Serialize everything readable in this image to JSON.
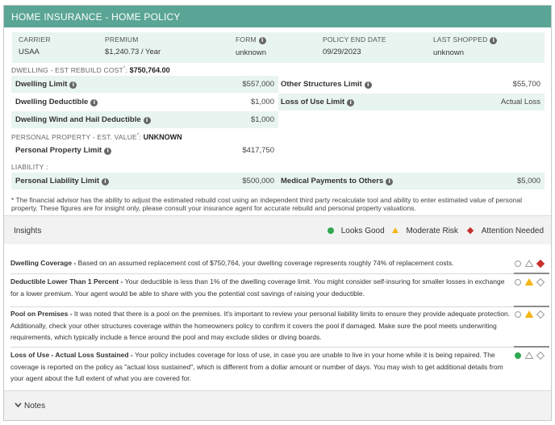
{
  "header": {
    "title": "HOME INSURANCE - HOME POLICY"
  },
  "summary": {
    "carrier": {
      "label": "CARRIER",
      "value": "USAA"
    },
    "premium": {
      "label": "PREMIUM",
      "value": "$1,240.73 / Year"
    },
    "form": {
      "label": "FORM",
      "value": "unknown"
    },
    "end_date": {
      "label": "POLICY END DATE",
      "value": "09/29/2023"
    },
    "last_shopped": {
      "label": "LAST SHOPPED",
      "value": "unknown"
    }
  },
  "dwelling": {
    "title": "DWELLING - EST REBUILD COST",
    "marker": "*",
    "sep": ":",
    "value": "$750,764.00",
    "rows": {
      "dwelling_limit": {
        "label": "Dwelling Limit",
        "value": "$557,000"
      },
      "dwelling_deductible": {
        "label": "Dwelling Deductible",
        "value": "$1,000"
      },
      "wind_hail": {
        "label": "Dwelling Wind and Hail Deductible",
        "value": "$1,000"
      },
      "other_structures": {
        "label": "Other Structures Limit",
        "value": "$55,700"
      },
      "loss_of_use": {
        "label": "Loss of Use Limit",
        "value": "Actual Loss"
      }
    }
  },
  "personal_property": {
    "title": "PERSONAL PROPERTY - EST. VALUE",
    "marker": "*",
    "sep": ":",
    "value": "UNKNOWN",
    "limit": {
      "label": "Personal Property Limit",
      "value": "$417,750"
    }
  },
  "liability": {
    "title": "LIABILITY :",
    "personal_liability": {
      "label": "Personal Liability Limit",
      "value": "$500,000"
    },
    "medical_payments": {
      "label": "Medical Payments to Others",
      "value": "$5,000"
    }
  },
  "footnote": "* The financial advisor has the ability to adjust the estimated rebuild cost using an independent third party recalculate tool and ability to enter estimated value of personal property. These figures are for insight only, please consult your insurance agent for accurate rebuild and personal property valuations.",
  "insights": {
    "title": "Insights",
    "legend": {
      "good": "Looks Good",
      "moderate": "Moderate Risk",
      "attention": "Attention Needed"
    },
    "colors": {
      "good": "#2fa84f",
      "moderate": "#f3b617",
      "attention": "#c9302c"
    },
    "items": [
      {
        "title": "Dwelling Coverage - ",
        "text": "Based on an assumed replacement cost of $750,764, your dwelling coverage represents roughly 74% of replacement costs.",
        "status": "attention"
      },
      {
        "title": "Deductible Lower Than 1 Percent - ",
        "text": "Your deductible is less than 1% of the dwelling coverage limit. You might consider self-insuring for smaller losses in exchange for a lower premium. Your agent would be able to share with you the potential cost savings of raising your deductible.",
        "status": "moderate"
      },
      {
        "title": "Pool on Premises - ",
        "text": "It was noted that there is a pool on the premises. It's important to review your personal liability limits to ensure they provide adequate protection. Additionally, check your other structures coverage within the homeowners policy to confirm it covers the pool if damaged. Make sure the pool meets underwriting requirements, which typically include a fence around the pool and may exclude slides or diving boards.",
        "status": "moderate"
      },
      {
        "title": "Loss of Use - Actual Loss Sustained - ",
        "text": "Your policy includes coverage for loss of use, in case you are unable to live in your home while it is being repaired. The coverage is reported on the policy as \"actual loss sustained\", which is different from a dollar amount or number of days. You may wish to get additional details from your agent about the full extent of what you are covered for.",
        "status": "good"
      }
    ]
  },
  "notes": {
    "label": "Notes"
  }
}
